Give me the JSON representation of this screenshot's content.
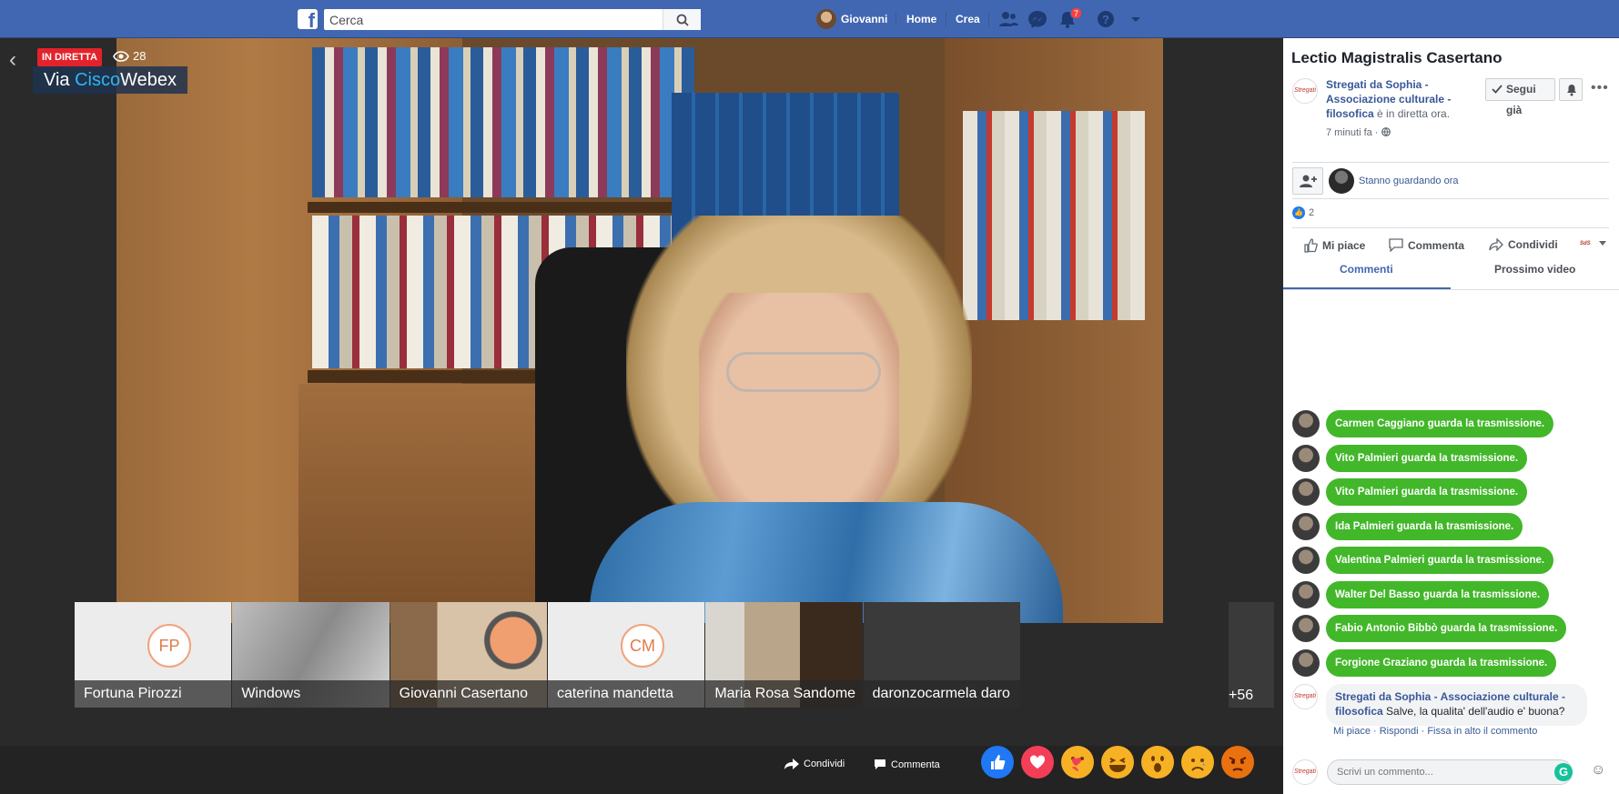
{
  "topbar": {
    "logo": "f",
    "search_placeholder": "Cerca",
    "user_name": "Giovanni",
    "home": "Home",
    "create": "Crea",
    "notifications_count": "7"
  },
  "video": {
    "live_label": "IN DIRETTA",
    "viewers": "28",
    "source_prefix": "Via ",
    "source_brand": "Cisco",
    "source_suffix": "Webex"
  },
  "participants": [
    {
      "initials": "FP",
      "name": "Fortuna Pirozzi"
    },
    {
      "initials": "",
      "name": "Windows"
    },
    {
      "initials": "",
      "name": "Giovanni Casertano"
    },
    {
      "initials": "CM",
      "name": "caterina mandetta"
    },
    {
      "initials": "",
      "name": "Maria Rosa Sandome"
    },
    {
      "initials": "",
      "name": "daronzocarmela daro"
    }
  ],
  "more_participants": "+56",
  "bottombar": {
    "share": "Condividi",
    "comment": "Commenta"
  },
  "panel": {
    "title": "Lectio Magistralis Casertano",
    "page_name": "Stregati da Sophia - Associazione culturale - filosofica",
    "live_status": " è in diretta ora.",
    "time": "7 minuti fa · ",
    "follow": "Segui già",
    "watching": "Stanno guardando ora",
    "likes": "2",
    "actions": {
      "like": "Mi piace",
      "comment": "Commenta",
      "share": "Condividi"
    },
    "tabs": {
      "comments": "Commenti",
      "next": "Prossimo video"
    },
    "events": [
      "Carmen Caggiano guarda la trasmissione.",
      "Vito Palmieri guarda la trasmissione.",
      "Vito Palmieri guarda la trasmissione.",
      "Ida Palmieri guarda la trasmissione.",
      "Valentina Palmieri guarda la trasmissione.",
      "Walter Del Basso guarda la trasmissione.",
      "Fabio Antonio Bibbò guarda la trasmissione.",
      "Forgione Graziano guarda la trasmissione."
    ],
    "comment": {
      "author": "Stregati da Sophia - Associazione culturale - filosofica",
      "text": " Salve, la qualita' dell'audio e' buona?",
      "actions": "Mi piace · Rispondi · Fissa in alto il commento"
    },
    "comment_placeholder": "Scrivi un commento...",
    "avatar_text": "Stregati da Sophia"
  },
  "colors": {
    "brand": "#4267b2",
    "live": "#e4222b",
    "event_green": "#42b72a"
  }
}
